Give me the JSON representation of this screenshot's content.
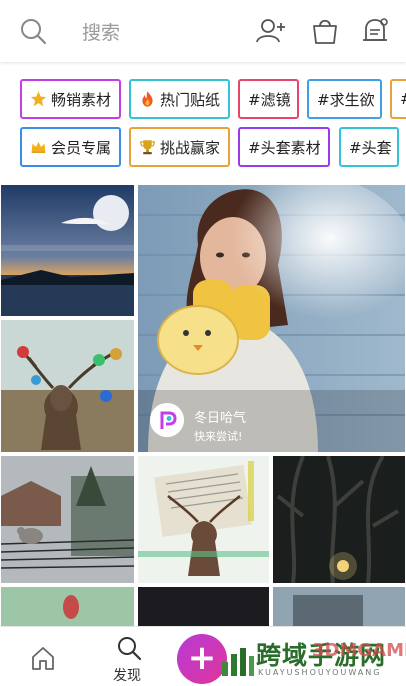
{
  "header": {
    "search_placeholder": "搜索",
    "icons": [
      "search-icon",
      "add-user-icon",
      "shop-bag-icon",
      "notification-bell-icon"
    ]
  },
  "tags_row1": [
    {
      "label": "畅销素材",
      "icon": "star-icon",
      "border": "#c43de6"
    },
    {
      "label": "热门贴纸",
      "icon": "fire-icon",
      "border": "#36c2d6"
    },
    {
      "label": "#滤镜",
      "icon": "",
      "border": "#e8456b"
    },
    {
      "label": "#求生欲",
      "icon": "",
      "border": "#3fa0e8"
    },
    {
      "label": "#",
      "icon": "",
      "border": "#e8a23a"
    }
  ],
  "tags_row2": [
    {
      "label": "会员专属",
      "icon": "crown-icon",
      "border": "#3a8ee8"
    },
    {
      "label": "挑战赢家",
      "icon": "trophy-icon",
      "border": "#e8a23a"
    },
    {
      "label": "#头套素材",
      "icon": "",
      "border": "#9b3ae8"
    },
    {
      "label": "#头套",
      "icon": "",
      "border": "#36c2d6"
    }
  ],
  "promo": {
    "title": "冬日哈气",
    "subtitle": "快来尝试!"
  },
  "bottom_nav": {
    "discover_label": "发现",
    "fab_symbol": "+"
  },
  "watermark": {
    "title": "跨域手游网",
    "badge": "3DMGAME",
    "subtitle": "KUAYUSHOUYOUWANG"
  },
  "colors": {
    "accent": "#c43de6",
    "fab_gradient": [
      "#b63bd6",
      "#e0349a"
    ]
  }
}
